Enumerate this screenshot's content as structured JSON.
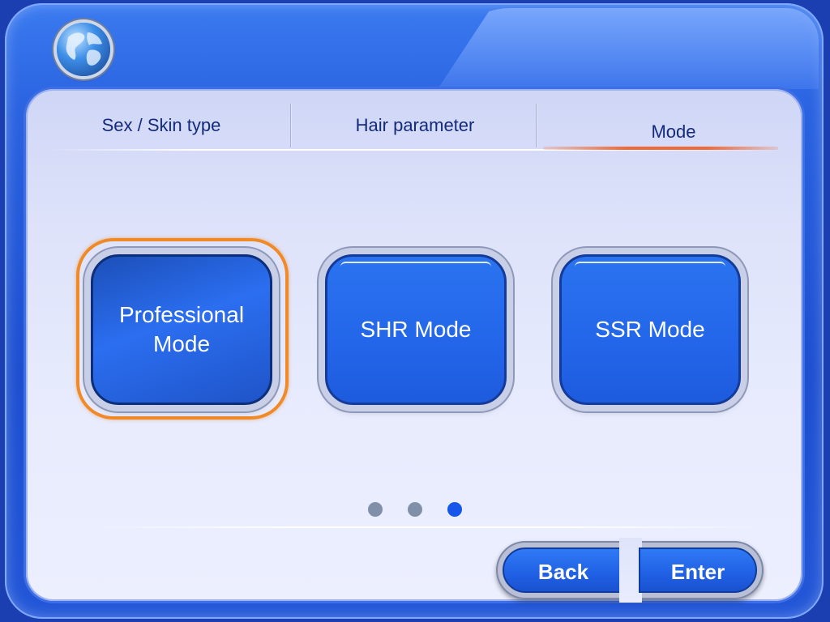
{
  "tabs": [
    {
      "label": "Sex / Skin  type",
      "active": false
    },
    {
      "label": "Hair  parameter",
      "active": false
    },
    {
      "label": "Mode",
      "active": true
    }
  ],
  "modes": [
    {
      "line1": "Professional",
      "line2": "Mode",
      "selected": true
    },
    {
      "label": "SHR Mode",
      "selected": false
    },
    {
      "label": "SSR Mode",
      "selected": false
    }
  ],
  "pagination": {
    "current_page": 3,
    "total_pages": 3
  },
  "actions": {
    "back_label": "Back",
    "enter_label": "Enter"
  },
  "colors": {
    "frame_blue": "#2a62e0",
    "panel_bg": "#e3e7fc",
    "button_blue": "#2467ea",
    "selected_ring": "#f08a28",
    "tab_active_underline": "#ef6a3a",
    "dot_active": "#1657ea",
    "dot_inactive": "#8090a8"
  },
  "icons": {
    "logo": "globe-icon"
  }
}
